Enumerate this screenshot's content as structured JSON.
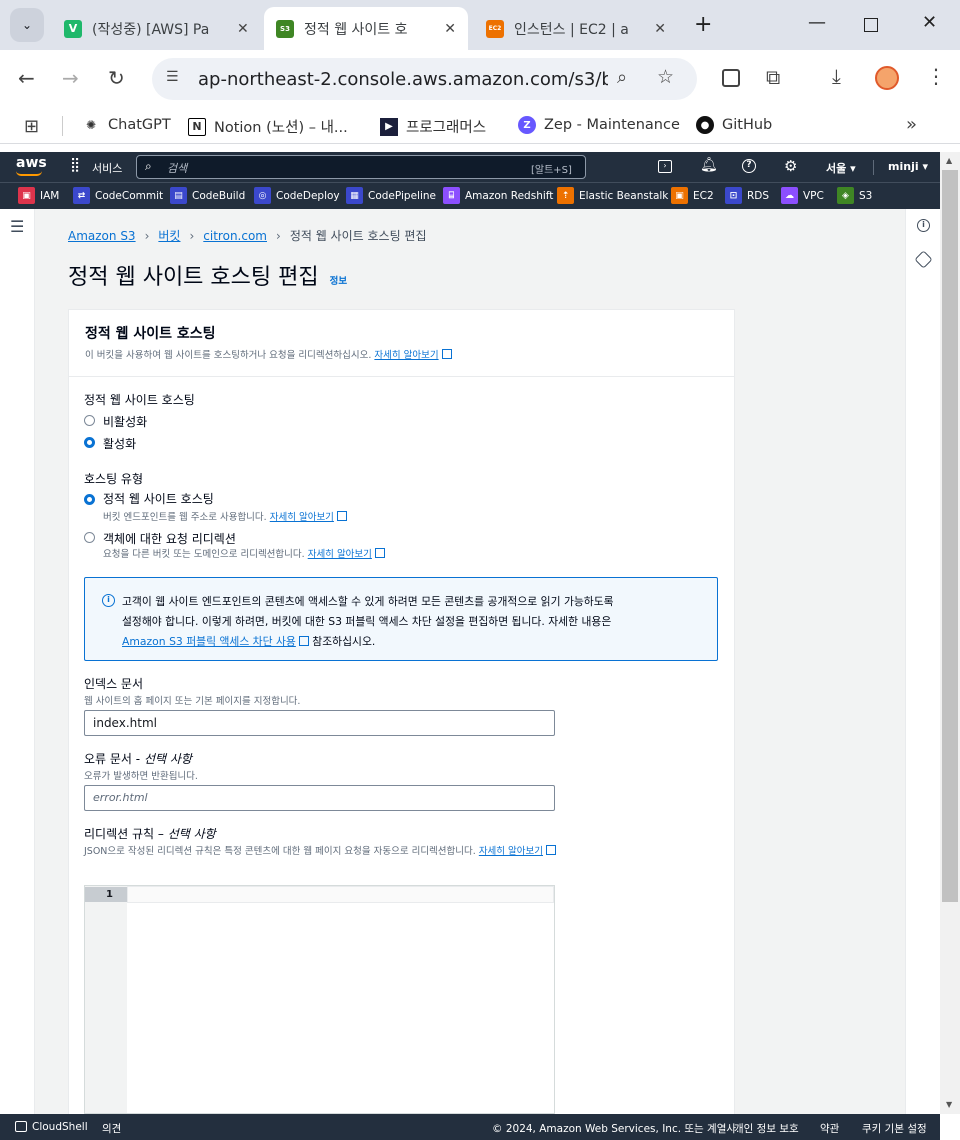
{
  "browser": {
    "tabs": [
      {
        "title": "(작성중) [AWS] Pa",
        "icon": "V",
        "color": "#1fb86b"
      },
      {
        "title": "정적 웹 사이트 호",
        "icon": "S3",
        "color": "#3f8624"
      },
      {
        "title": "인스턴스 | EC2 | a",
        "icon": "EC2",
        "color": "#ed7100"
      }
    ],
    "url": "ap-northeast-2.console.aws.amazon.com/s3/buck...",
    "bookmarks": [
      "ChatGPT",
      "Notion (노션) – 내...",
      "프로그래머스",
      "Zep - Maintenance",
      "GitHub"
    ]
  },
  "aws": {
    "logo": "aws",
    "services_label": "서비스",
    "search_placeholder": "검색",
    "search_shortcut": "[알트+S]",
    "region": "서울",
    "user": "minji",
    "favorites": [
      {
        "label": "IAM",
        "color": "#dd344c"
      },
      {
        "label": "CodeCommit",
        "color": "#7b3fe4"
      },
      {
        "label": "CodeBuild",
        "color": "#7b3fe4"
      },
      {
        "label": "CodeDeploy",
        "color": "#7b3fe4"
      },
      {
        "label": "CodePipeline",
        "color": "#7b3fe4"
      },
      {
        "label": "Amazon Redshift",
        "color": "#8c4fff"
      },
      {
        "label": "Elastic Beanstalk",
        "color": "#ed7100"
      },
      {
        "label": "EC2",
        "color": "#ed7100"
      },
      {
        "label": "RDS",
        "color": "#3b48cc"
      },
      {
        "label": "VPC",
        "color": "#8c4fff"
      },
      {
        "label": "S3",
        "color": "#3f8624"
      }
    ]
  },
  "breadcrumb": [
    "Amazon S3",
    "버킷",
    "citron.com",
    "정적 웹 사이트 호스팅 편집"
  ],
  "page_title": "정적 웹 사이트 호스팅 편집",
  "info_link": "정보",
  "panel": {
    "header": "정적 웹 사이트 호스팅",
    "header_desc": "이 버킷을 사용하여 웹 사이트를 호스팅하거나 요청을 리디렉션하십시오.",
    "learn_more": "자세히 알아보기",
    "hosting_label": "정적 웹 사이트 호스팅",
    "disable": "비활성화",
    "enable": "활성화",
    "type_label": "호스팅 유형",
    "type_static": "정적 웹 사이트 호스팅",
    "type_static_desc": "버킷 엔드포인트를 웹 주소로 사용합니다.",
    "type_redirect": "객체에 대한 요청 리디렉션",
    "type_redirect_desc": "요청을 다른 버킷 또는 도메인으로 리디렉션합니다.",
    "alert_line1": "고객이 웹 사이트 엔드포인트의 콘텐츠에 액세스할 수 있게 하려면 모든 콘텐츠를 공개적으로 읽기 가능하도록",
    "alert_line2": "설정해야 합니다. 이렇게 하려면, 버킷에 대한 S3 퍼블릭 액세스 차단 설정을 편집하면 됩니다. 자세한 내용은",
    "alert_link": "Amazon S3 퍼블릭 액세스 차단 사용",
    "alert_tail": "참조하십시오.",
    "index_label": "인덱스 문서",
    "index_desc": "웹 사이트의 홈 페이지 또는 기본 페이지를 지정합니다.",
    "index_value": "index.html",
    "error_label": "오류 문서 - ",
    "error_optional": "선택 사항",
    "error_desc": "오류가 발생하면 반환됩니다.",
    "error_placeholder": "error.html",
    "redirect_label": "리디렉션 규칙 – ",
    "redirect_optional": "선택 사항",
    "redirect_desc": "JSON으로 작성된 리디렉션 규칙은 특정 콘텐츠에 대한 웹 페이지 요청을 자동으로 리디렉션합니다.",
    "line_number": "1"
  },
  "footer": {
    "cloudshell": "CloudShell",
    "feedback": "의견",
    "copyright": "© 2024, Amazon Web Services, Inc. 또는 계열사.",
    "privacy": "개인 정보 보호",
    "terms": "약관",
    "cookies": "쿠키 기본 설정"
  }
}
